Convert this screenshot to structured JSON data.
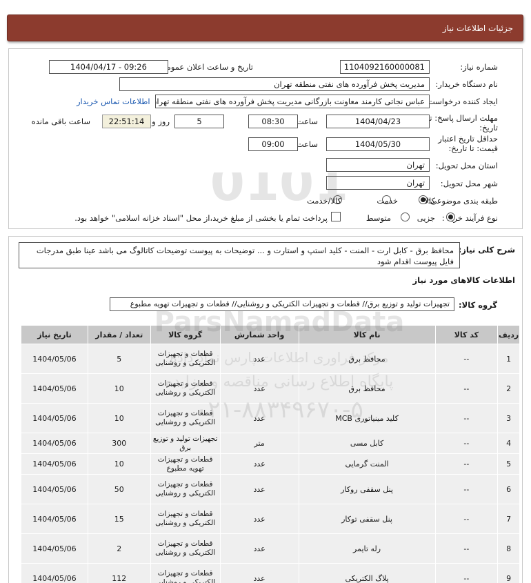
{
  "title": "جزئیات اطلاعات نیاز",
  "fields": {
    "need_number_label": "شماره نیاز:",
    "need_number": "1104092160000081",
    "announce_label": "تاریخ و ساعت اعلان عمومی:",
    "announce_value": "1404/04/17 - 09:26",
    "buyer_label": "نام دستگاه خریدار:",
    "buyer": "مدیریت پخش فرآورده های نفتی منطقه تهران",
    "creator_label": "ایجاد کننده درخواست:",
    "creator": "عباس نجاتی کارمند معاونت بازرگانی مدیریت پخش فرآورده های نفتی منطقه تهران",
    "contact_link": "اطلاعات تماس خریدار",
    "deadline_label_1": "مهلت ارسال پاسخ: تا",
    "deadline_label_2": "تاریخ:",
    "deadline_date": "1404/04/23",
    "time_label": "ساعت",
    "deadline_time": "08:30",
    "days_value": "5",
    "days_label": "روز و",
    "remaining_time": "22:51:14",
    "remaining_label": "ساعت باقی مانده",
    "validity_label_1": "حداقل تاریخ اعتبار",
    "validity_label_2": "قیمت: تا تاریخ:",
    "validity_date": "1404/05/30",
    "validity_time": "09:00",
    "province_label": "استان محل تحویل:",
    "province": "تهران",
    "city_label": "شهر محل تحویل:",
    "city": "تهران",
    "category_label": "طبقه بندی موضوعی:",
    "category_options": [
      "کالا",
      "خدمت",
      "کالا/خدمت"
    ],
    "process_label": "نوع فرآیند خرید :",
    "process_options": [
      "جزیی",
      "متوسط"
    ],
    "payment_note": "پرداخت تمام یا بخشی از مبلغ خرید،از محل \"اسناد خزانه اسلامی\" خواهد بود."
  },
  "description": {
    "label": "شرح کلی نیاز:",
    "text": "محافظ برق - کابل ارت - المنت - کلید استپ و استارت و ... توضیحات به پیوست توضیحات کاتالوگ می باشد عینا طبق مدرجات فایل پیوست اقدام شود"
  },
  "goods_section_title": "اطلاعات کالاهای مورد نیاز",
  "goods_group_label": "گروه کالا:",
  "goods_group": "تجهیزات تولید و توزیع برق// قطعات و تجهیزات الکتریکی و روشنایی// قطعات و تجهیزات تهویه مطبوع",
  "table": {
    "headers": [
      "ردیف",
      "کد کالا",
      "نام کالا",
      "واحد شمارش",
      "گروه کالا",
      "تعداد / مقدار",
      "تاریخ نیاز"
    ],
    "rows": [
      {
        "row": "1",
        "code": "--",
        "name": "محافظ برق",
        "unit": "عدد",
        "group": "قطعات و تجهیزات الکتریکی و روشنایی",
        "qty": "5",
        "date": "1404/05/06"
      },
      {
        "row": "2",
        "code": "--",
        "name": "محافظ برق",
        "unit": "عدد",
        "group": "قطعات و تجهیزات الکتریکی و روشنایی",
        "qty": "10",
        "date": "1404/05/06"
      },
      {
        "row": "3",
        "code": "--",
        "name": "کلید مینیاتوری MCB",
        "unit": "عدد",
        "group": "قطعات و تجهیزات الکتریکی و روشنایی",
        "qty": "10",
        "date": "1404/05/06"
      },
      {
        "row": "4",
        "code": "--",
        "name": "کابل مسی",
        "unit": "متر",
        "group": "تجهیزات تولید و توزیع برق",
        "qty": "300",
        "date": "1404/05/06"
      },
      {
        "row": "5",
        "code": "--",
        "name": "المنت گرمایی",
        "unit": "عدد",
        "group": "قطعات و تجهیزات تهویه مطبوع",
        "qty": "10",
        "date": "1404/05/06"
      },
      {
        "row": "6",
        "code": "--",
        "name": "پنل سقفی روکار",
        "unit": "عدد",
        "group": "قطعات و تجهیزات الکتریکی و روشنایی",
        "qty": "50",
        "date": "1404/05/06"
      },
      {
        "row": "7",
        "code": "--",
        "name": "پنل سقفی توکار",
        "unit": "عدد",
        "group": "قطعات و تجهیزات الکتریکی و روشنایی",
        "qty": "15",
        "date": "1404/05/06"
      },
      {
        "row": "8",
        "code": "--",
        "name": "رله تایمر",
        "unit": "عدد",
        "group": "قطعات و تجهیزات الکتریکی و روشنایی",
        "qty": "2",
        "date": "1404/05/06"
      },
      {
        "row": "9",
        "code": "--",
        "name": "پلاگ الکتریکی",
        "unit": "عدد",
        "group": "قطعات و تجهیزات الکتریکی و روشنایی",
        "qty": "112",
        "date": "1404/05/06"
      }
    ]
  },
  "watermark": {
    "brand": "ParsNamadData",
    "line1": "مرکز فراوری اطلاعات پارس نماد داده",
    "line2": "پایگاه اطلاع رسانی مناقصه و مزایده",
    "phone": "۰۲۱-۸۸۳۴۹۶۷۰-۵",
    "digits": "0101"
  },
  "colors": {
    "title_bar": "#8c3b2e",
    "link": "#1a58b0",
    "table_header": "#c8c8c8",
    "table_cell": "#efefef"
  }
}
